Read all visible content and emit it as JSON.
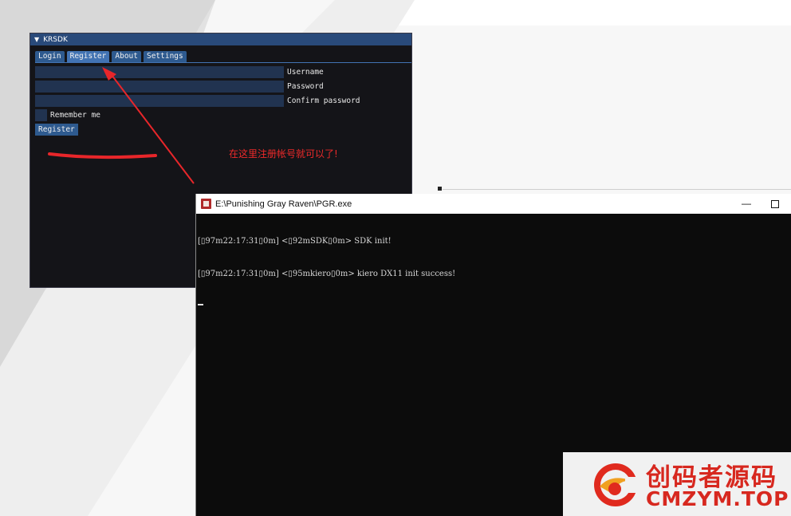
{
  "imgui": {
    "title": "KRSDK",
    "tabs": [
      "Login",
      "Register",
      "About",
      "Settings"
    ],
    "active_tab": "Register",
    "fields": [
      {
        "label": "Username",
        "value": ""
      },
      {
        "label": "Password",
        "value": ""
      },
      {
        "label": "Confirm password",
        "value": ""
      }
    ],
    "remember_label": "Remember me",
    "register_button": "Register"
  },
  "annotation": {
    "text": "在这里注册帐号就可以了!"
  },
  "console": {
    "title": "E:\\Punishing Gray Raven\\PGR.exe",
    "lines": [
      "[▯97m22:17:31▯0m] <▯92mSDK▯0m> SDK init!",
      "[▯97m22:17:31▯0m] <▯95mkiero▯0m> kiero DX11 init success!"
    ],
    "minimize_symbol": "—"
  },
  "watermark": {
    "cn": "创码者源码",
    "en": "CMZYM.TOP"
  },
  "colors": {
    "imgui_bg": "#141418",
    "imgui_title": "#294a7a",
    "imgui_tab": "#2e5a8f",
    "imgui_field": "#213350",
    "annotation_red": "#ee2a2a",
    "console_bg": "#0c0c0c",
    "watermark_red": "#d7281f"
  }
}
